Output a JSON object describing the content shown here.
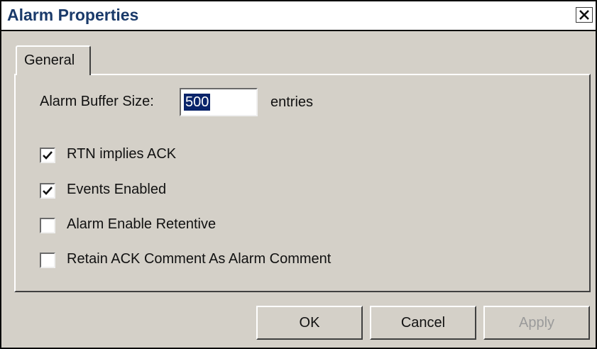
{
  "window": {
    "title": "Alarm Properties",
    "close_glyph": "close-icon"
  },
  "tabs": [
    {
      "label": "General",
      "active": true
    }
  ],
  "buffer": {
    "label": "Alarm Buffer Size:",
    "value": "500",
    "suffix": "entries"
  },
  "options": [
    {
      "label": "RTN implies ACK",
      "checked": true
    },
    {
      "label": "Events Enabled",
      "checked": true
    },
    {
      "label": "Alarm Enable Retentive",
      "checked": false
    },
    {
      "label": "Retain ACK Comment As Alarm Comment",
      "checked": false
    }
  ],
  "buttons": {
    "ok": "OK",
    "cancel": "Cancel",
    "apply": "Apply"
  },
  "colors": {
    "face": "#d4d0c8",
    "title_text": "#1a3a6a",
    "selection": "#0a246a",
    "disabled_text": "#9a9a9a"
  }
}
